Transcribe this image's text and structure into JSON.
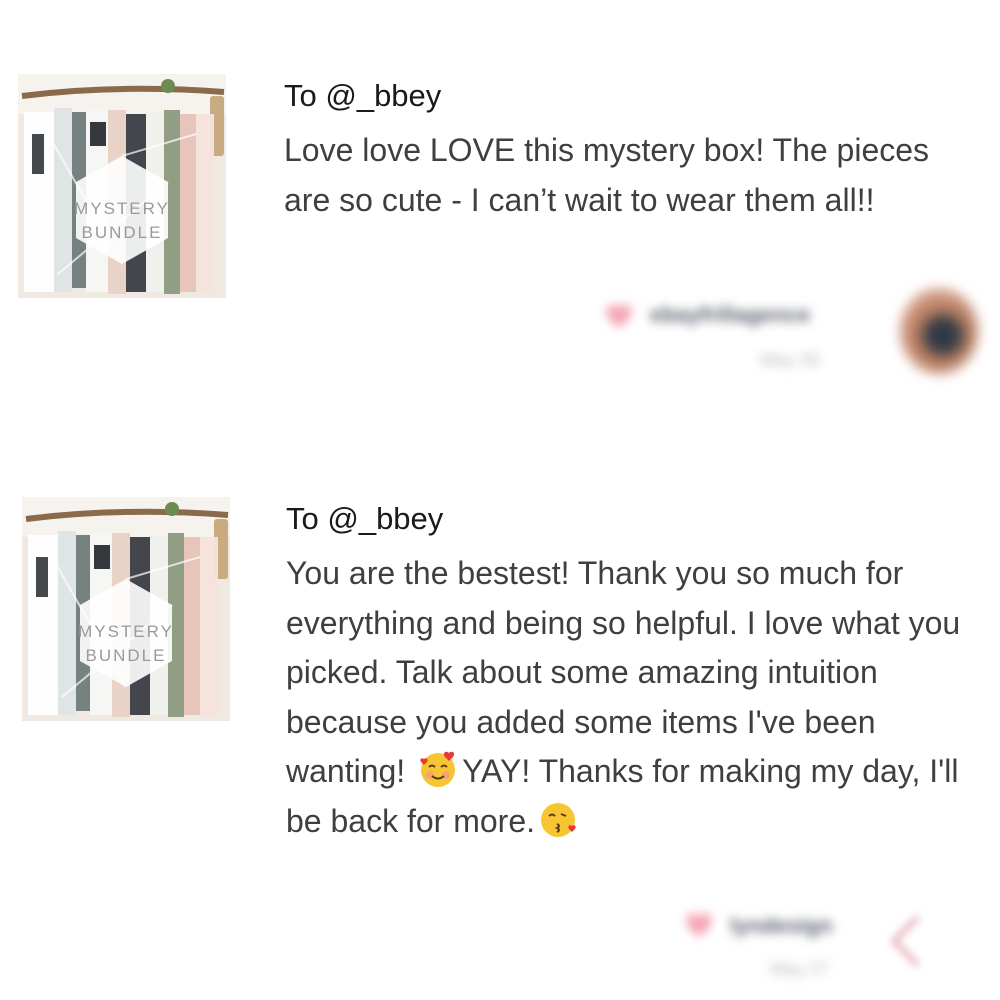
{
  "reviews": [
    {
      "thumbnail": {
        "line1": "MYSTERY",
        "line2": "BUNDLE"
      },
      "to_line": "To @_bbey",
      "message": "Love love LOVE this mystery box! The pieces are so cute - I can’t wait to wear them all!!",
      "reviewer": {
        "name": "ebayfrillagence",
        "date": "May 28"
      }
    },
    {
      "thumbnail": {
        "line1": "MYSTERY",
        "line2": "BUNDLE"
      },
      "to_line": "To @_bbey",
      "message_part1": "You are the bestest! Thank you so much for everything and being so helpful. I love what you picked. Talk about some amazing intuition because you added some items I've been wanting!",
      "emoji1": "smiling-face-with-hearts",
      "message_part2": "YAY! Thanks for making my day, I'll be back for more.",
      "emoji2": "face-blowing-a-kiss",
      "reviewer": {
        "name": "lyndesign",
        "date": "May 27"
      }
    }
  ],
  "colors": {
    "heart": "#f4a3b4",
    "text": "#3f3f3f",
    "heading": "#1a1a1a"
  }
}
